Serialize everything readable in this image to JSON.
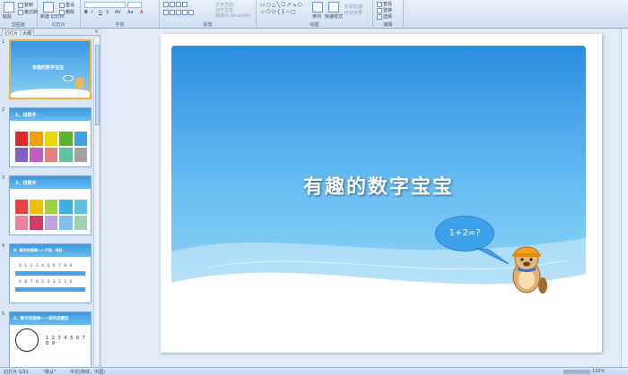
{
  "ribbon": {
    "groups": {
      "clipboard": {
        "label": "剪贴板",
        "copy": "复制",
        "format_painter": "格式刷",
        "paste": "粘贴"
      },
      "slides": {
        "label": "幻灯片",
        "new_slide": "新建\n幻灯片",
        "reset": "重设",
        "delete": "删除"
      },
      "font": {
        "label": "字体"
      },
      "paragraph": {
        "label": "段落",
        "text_direction": "文字方向",
        "align_text": "对齐文本",
        "smartart": "转换为 SmartArt"
      },
      "drawing": {
        "label": "绘图",
        "arrange": "排列",
        "quick_styles": "快速样式",
        "shape_fill": "形状轮廓",
        "shape_effects": "形状效果"
      },
      "editing": {
        "label": "编辑",
        "find": "查找",
        "replace": "替换",
        "select": "选择"
      }
    }
  },
  "panel_tabs": {
    "slides": "幻灯片",
    "outline": "大纲"
  },
  "thumbnails": [
    {
      "number": "1",
      "title": "有趣的数字宝宝"
    },
    {
      "number": "2",
      "title": "1、找数字"
    },
    {
      "number": "3",
      "title": "2、找数字"
    },
    {
      "number": "4",
      "title": "3、数字的规律——不规，排队"
    },
    {
      "number": "5",
      "title": "2、数字的规律——排列成图形"
    }
  ],
  "thumb_contents": {
    "thumb4_row1": "0 1 2 3 4 5 6 7 8 9",
    "thumb4_row2": "9 8 7 6 5 4 3 2 1 0",
    "thumb5_numbers": "1 2 3 4 5 6 7 8 9"
  },
  "slide": {
    "title": "有趣的数字宝宝",
    "bubble_text": "1+2=?"
  },
  "status": {
    "slide_info": "幻灯片 1/31",
    "theme": "\"默认\"",
    "language": "中文(简体，中国)",
    "zoom": "132%"
  },
  "colors": {
    "slide_blue": "#2a8ee0",
    "slide_light": "#9ed8f8",
    "bubble": "#3da2ec"
  },
  "grid_colors_2": [
    "#e02a2a",
    "#f0a000",
    "#e8d800",
    "#60b030",
    "#40a0e0",
    "#8060c0",
    "#c060c0",
    "#e08080",
    "#60c0a0",
    "#a0a0a0"
  ],
  "grid_colors_3": [
    "#e84040",
    "#f0c000",
    "#a0d040",
    "#40b0e0",
    "#60c0e0",
    "#f080a0",
    "#d04060",
    "#c0a0e0",
    "#80c0f0",
    "#a0d0b0"
  ]
}
